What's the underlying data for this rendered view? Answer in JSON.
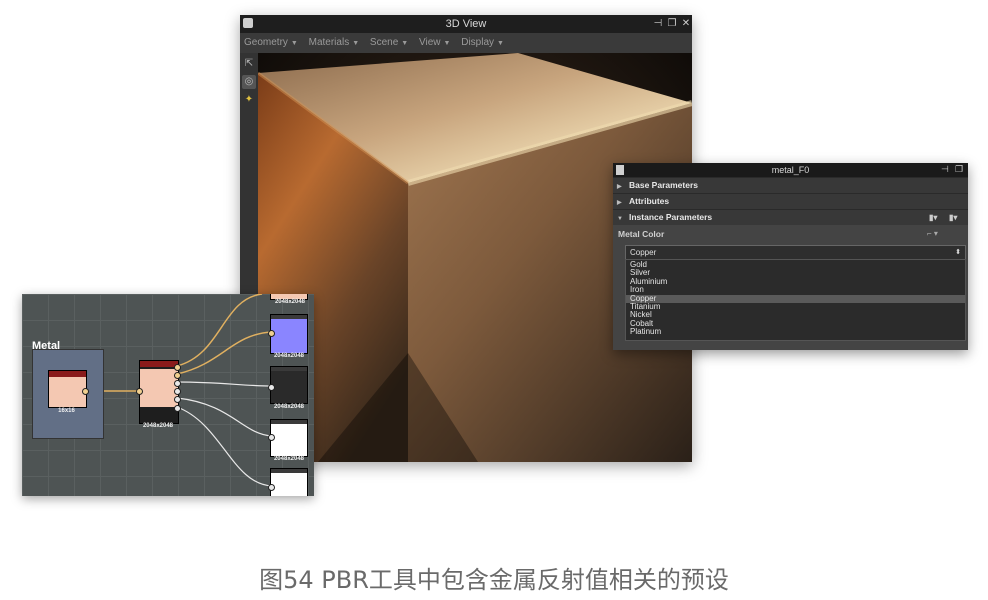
{
  "view3d": {
    "title": "3D View",
    "menus": [
      "Geometry",
      "Materials",
      "Scene",
      "View",
      "Display"
    ]
  },
  "graph": {
    "frame_label": "Metal",
    "source_node": {
      "size": "16x16"
    },
    "filter_node": {
      "size": "2048x2048"
    },
    "outputs": [
      "2048x2048",
      "2048x2048",
      "2048x2048"
    ]
  },
  "panel": {
    "title": "metal_F0",
    "sections": [
      "Base Parameters",
      "Attributes",
      "Instance Parameters"
    ],
    "field_label": "Metal Color",
    "selected": "Copper",
    "options": [
      "Gold",
      "Silver",
      "Aluminium",
      "Iron",
      "Copper",
      "Titanium",
      "Nickel",
      "Cobalt",
      "Platinum"
    ]
  },
  "caption": "图54 PBR工具中包含金属反射值相关的预设",
  "colors": {
    "copper_node": "#f4c8b2",
    "normal_node": "#8a85ff",
    "node_header": "#8a1b1b"
  }
}
